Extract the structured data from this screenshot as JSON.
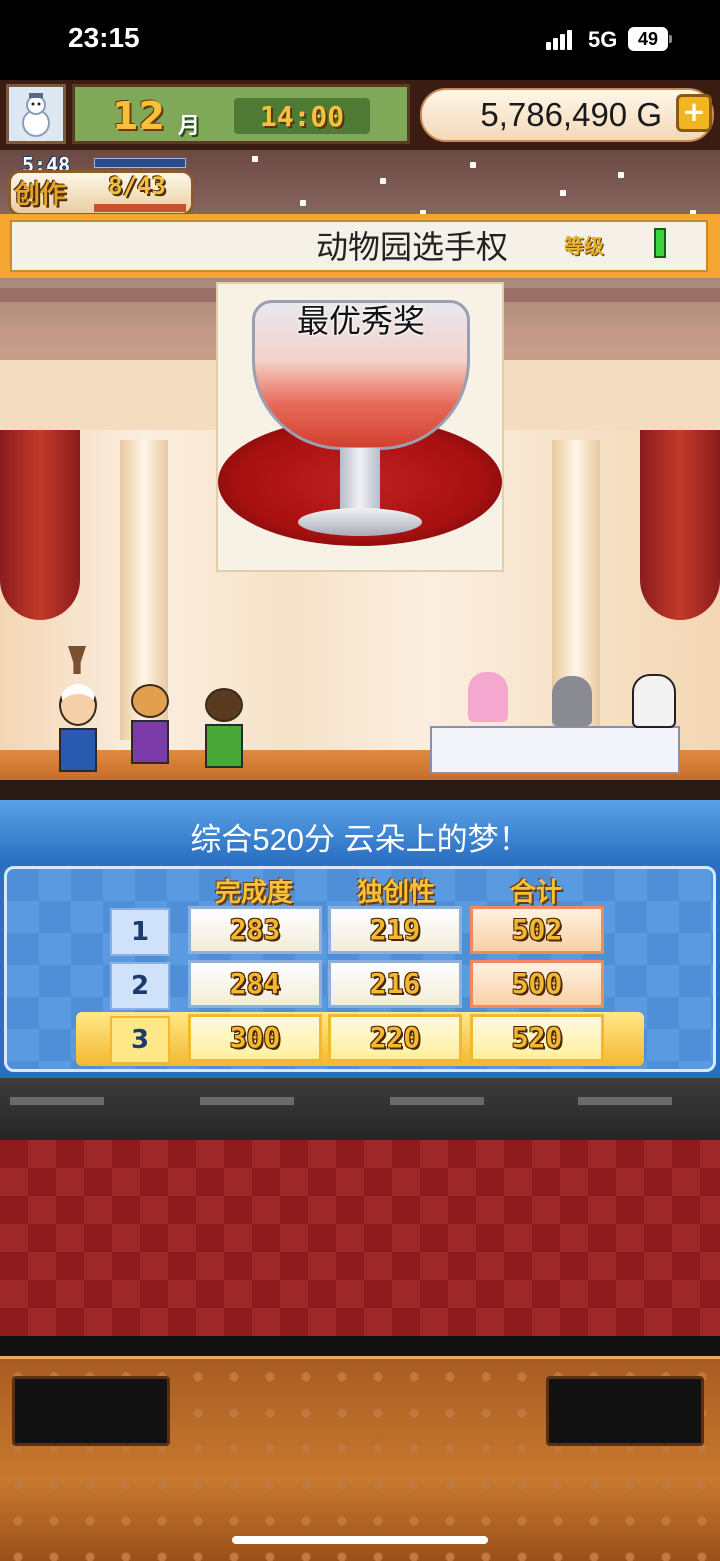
{
  "status_bar": {
    "time": "23:15",
    "network": "5G",
    "battery": "49"
  },
  "hud": {
    "month_number": "12",
    "month_unit": "月",
    "clock": "14:00",
    "money": "5,786,490 G",
    "timer": "5:48",
    "create_label": "创作",
    "create_count": "8/43"
  },
  "contest": {
    "title": "动物园选手权",
    "rank_label": "等级",
    "award": "最优秀奖"
  },
  "results": {
    "comment": "综合520分 云朵上的梦！",
    "columns": [
      "完成度",
      "独创性",
      "合计"
    ],
    "rows": [
      {
        "rank": "1",
        "completion": "283",
        "originality": "219",
        "total": "502"
      },
      {
        "rank": "2",
        "completion": "284",
        "originality": "216",
        "total": "500"
      },
      {
        "rank": "3",
        "completion": "300",
        "originality": "220",
        "total": "520"
      }
    ]
  },
  "colors": {
    "score_gold": "#f4b830",
    "panel_blue": "#2a6fc2",
    "carpet_red": "#8e1c1e"
  }
}
